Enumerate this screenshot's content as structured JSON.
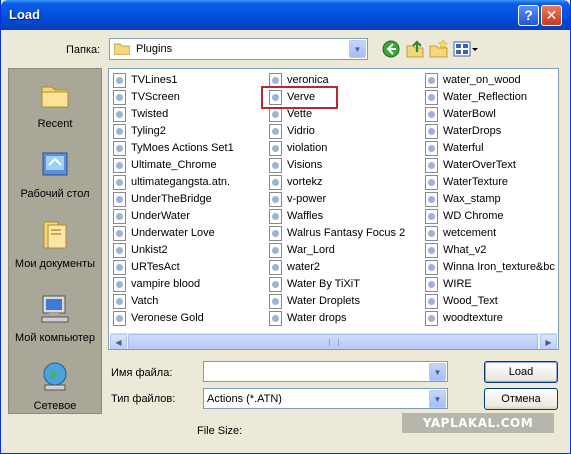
{
  "window": {
    "title": "Load",
    "help_label": "?",
    "close_label": "✕"
  },
  "lookin": {
    "label": "Папка:",
    "value": "Plugins",
    "icon": "folder-icon"
  },
  "toolbar": {
    "back_icon": "back-arrow-icon",
    "up_icon": "up-folder-icon",
    "newfolder_icon": "new-folder-icon",
    "views_icon": "views-menu-icon"
  },
  "places": [
    {
      "label": "Recent",
      "icon": "recent-icon"
    },
    {
      "label": "Рабочий стол",
      "icon": "desktop-icon"
    },
    {
      "label": "Мои документы",
      "icon": "my-documents-icon"
    },
    {
      "label": "Мой компьютер",
      "icon": "my-computer-icon"
    },
    {
      "label": "Сетевое",
      "icon": "network-icon"
    }
  ],
  "files": {
    "col1": [
      "TVLines1",
      "TVScreen",
      "Twisted",
      "Tyling2",
      "TyMoes Actions Set1",
      "Ultimate_Chrome",
      "ultimategangsta.atn.",
      "UnderTheBridge",
      "UnderWater",
      "Underwater Love",
      "Unkist2",
      "URTesAct",
      "vampire blood",
      "Vatch",
      "Veronese Gold"
    ],
    "col2": [
      "veronica",
      "Verve",
      "Vette",
      "Vidrio",
      "violation",
      "Visions",
      "vortekz",
      "v-power",
      "Waffles",
      "Walrus Fantasy Focus 2",
      "War_Lord",
      "water2",
      "Water By TiXiT",
      "Water Droplets",
      "Water drops"
    ],
    "col3": [
      "water_on_wood",
      "Water_Reflection",
      "WaterBowl",
      "WaterDrops",
      "Waterful",
      "WaterOverText",
      "WaterTexture",
      "Wax_stamp",
      "WD Chrome",
      "wetcement",
      "What_v2",
      "Winna Iron_texture&bc",
      "WIRE",
      "Wood_Text",
      "woodtexture"
    ]
  },
  "form": {
    "filename_label": "Имя файла:",
    "filename_value": "",
    "filetype_label": "Тип файлов:",
    "filetype_value": "Actions (*.ATN)",
    "filesize_label": "File Size:"
  },
  "buttons": {
    "load": "Load",
    "cancel": "Отмена"
  },
  "watermark": "YAPLAKAL.COM",
  "colors": {
    "titlebar": "#0554e3",
    "highlight_box": "#c0272d",
    "dialog_bg": "#ece9d8"
  }
}
